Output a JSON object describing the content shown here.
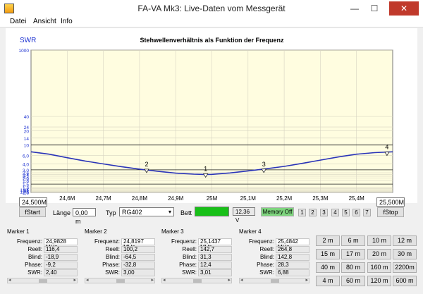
{
  "window": {
    "title": "FA-VA Mk3:   Live-Daten vom Messgerät",
    "controls": {
      "minimize": "—",
      "maximize": "☐",
      "close": "✕"
    }
  },
  "menu": [
    "Datei",
    "Ansicht",
    "Info"
  ],
  "chart_data": {
    "type": "line",
    "title": "Stehwellenverhältnis als Funktion der Frequenz",
    "ylabel": "SWR",
    "xlabel": "",
    "xlim": [
      24.5,
      25.5
    ],
    "x_ticks": [
      24.6,
      24.7,
      24.8,
      24.9,
      25.0,
      25.1,
      25.2,
      25.3,
      25.4
    ],
    "x_tick_labels": [
      "24,6M",
      "24,7M",
      "24,8M",
      "24,9M",
      "25M",
      "25,1M",
      "25,2M",
      "25,3M",
      "25,4M"
    ],
    "y_scale": "log",
    "ylim": [
      1.0,
      1000
    ],
    "y_ticks": [
      1.0,
      1.05,
      1.1,
      1.15,
      1.2,
      1.3,
      1.5,
      1.8,
      2.0,
      2.2,
      2.4,
      2.6,
      3.0,
      4.0,
      6.0,
      10,
      14,
      20,
      24,
      40,
      1000
    ],
    "y_tick_labels": [
      "1,0",
      "1,05",
      "1,1",
      "1,15",
      "1,2",
      "1,3",
      "1,5",
      "1,8",
      "2,0",
      "2,2",
      "2,4",
      "2,6",
      "3,0",
      "4,0",
      "6,0",
      "10",
      "14",
      "20",
      "24",
      "40",
      "1000"
    ],
    "hlines": [
      1.5,
      3.0,
      10
    ],
    "grid": true,
    "series": [
      {
        "color": "#2a34b8",
        "x": [
          24.5,
          24.55,
          24.6,
          24.65,
          24.7,
          24.75,
          24.8,
          24.85,
          24.9,
          24.95,
          24.98,
          25.0,
          25.05,
          25.1,
          25.15,
          25.2,
          25.25,
          25.3,
          25.35,
          25.4,
          25.45,
          25.5
        ],
        "y": [
          7.2,
          6.4,
          5.4,
          4.6,
          4.0,
          3.5,
          3.1,
          2.8,
          2.55,
          2.43,
          2.4,
          2.41,
          2.58,
          2.85,
          3.15,
          3.55,
          4.1,
          4.8,
          5.6,
          6.4,
          6.9,
          7.2
        ]
      }
    ],
    "markers": [
      {
        "label": "1",
        "x": 24.9828,
        "y": 2.4
      },
      {
        "label": "2",
        "x": 24.8197,
        "y": 3.0
      },
      {
        "label": "3",
        "x": 25.1437,
        "y": 3.01
      },
      {
        "label": "4",
        "x": 25.4842,
        "y": 6.88
      }
    ]
  },
  "controls": {
    "fstart_value": "24,500M",
    "fstart_button": "fStart",
    "fstop_value": "25,500M",
    "fstop_button": "fStop",
    "laenge_label": "Länge",
    "laenge_value": "0,00 m",
    "typ_label": "Typ",
    "typ_value": "RG402",
    "bett_label": "Bett",
    "battery_color": "#18c018",
    "voltage": "12,36 V",
    "memory_off": "Memory Off",
    "memory_numbers": [
      "1",
      "2",
      "3",
      "4",
      "5",
      "6",
      "7"
    ]
  },
  "markers": [
    {
      "title": "Marker 1",
      "fields": [
        [
          "Frequenz:",
          "24,9828 MHz"
        ],
        [
          "Reell:",
          "116,4"
        ],
        [
          "Blind:",
          "-18,9"
        ],
        [
          "Phase:",
          "-9,2"
        ],
        [
          "SWR:",
          "2,40"
        ]
      ]
    },
    {
      "title": "Marker 2",
      "fields": [
        [
          "Frequenz:",
          "24,8197 MHz"
        ],
        [
          "Reell:",
          "100,2"
        ],
        [
          "Blind:",
          "-64,5"
        ],
        [
          "Phase:",
          "-32,8"
        ],
        [
          "SWR:",
          "3,00"
        ]
      ]
    },
    {
      "title": "Marker 3",
      "fields": [
        [
          "Frequenz:",
          "25,1437 MHz"
        ],
        [
          "Reell:",
          "142,7"
        ],
        [
          "Blind:",
          "31,3"
        ],
        [
          "Phase:",
          "12,4"
        ],
        [
          "SWR:",
          "3,01"
        ]
      ]
    },
    {
      "title": "Marker 4",
      "fields": [
        [
          "Frequenz:",
          "25,4842 MHz"
        ],
        [
          "Reell:",
          "264,8"
        ],
        [
          "Blind:",
          "142,8"
        ],
        [
          "Phase:",
          "28,3"
        ],
        [
          "SWR:",
          "6,88"
        ]
      ]
    }
  ],
  "bands": [
    [
      "2 m",
      "6 m",
      "10 m",
      "12 m"
    ],
    [
      "15 m",
      "17 m",
      "20 m",
      "30 m"
    ],
    [
      "40 m",
      "80 m",
      "160 m",
      "2200m"
    ],
    [
      "4 m",
      "60 m",
      "120 m",
      "600 m"
    ]
  ]
}
